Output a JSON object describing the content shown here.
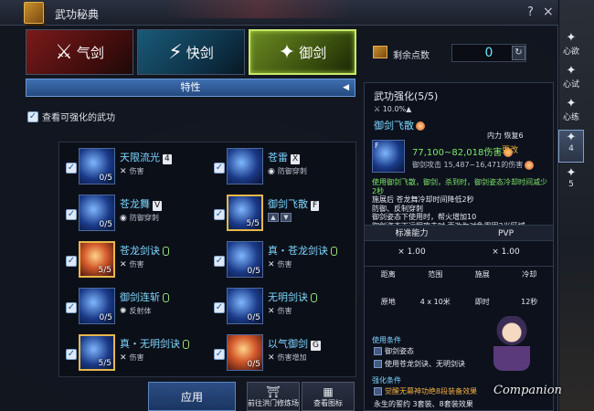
{
  "window": {
    "title": "武功秘典",
    "help": "?",
    "close": "×"
  },
  "tabs": [
    {
      "label": "气剑"
    },
    {
      "label": "快剑"
    },
    {
      "label": "御剑",
      "selected": true
    }
  ],
  "points": {
    "label": "剩余点数",
    "value": "0"
  },
  "feature_bar": {
    "label": "特性"
  },
  "filter": {
    "label": "查看可强化的武功",
    "checked": true
  },
  "skills": [
    {
      "name": "天限流光",
      "key": "4",
      "level": "0/5",
      "tag": "伤害"
    },
    {
      "name": "苍雷",
      "key": "X",
      "level": "",
      "tag": "防御穿刺"
    },
    {
      "name": "苍龙舞",
      "key": "V",
      "level": "0/5",
      "tag": "防御穿刺"
    },
    {
      "name": "御剑飞散",
      "key": "F",
      "level": "5/5",
      "tag": ""
    },
    {
      "name": "苍龙剑诀",
      "key": "",
      "level": "5/5",
      "tag": "伤害"
    },
    {
      "name": "真・苍龙剑诀",
      "key": "",
      "level": "0/5",
      "tag": "伤害"
    },
    {
      "name": "御剑连斩",
      "key": "",
      "level": "0/5",
      "tag": "反射体"
    },
    {
      "name": "无明剑诀",
      "key": "",
      "level": "0/5",
      "tag": "伤害"
    },
    {
      "name": "真・无明剑诀",
      "key": "",
      "level": "5/5",
      "tag": "伤害"
    },
    {
      "name": "以气御剑",
      "key": "G",
      "level": "0/5",
      "tag": "伤害增加"
    }
  ],
  "buttons": {
    "apply": "应用",
    "training": "前往洪门修炼场",
    "view_icons": "查看图标"
  },
  "detail": {
    "title": "武功强化(5/5)",
    "percent": "10.0%▲",
    "skill_name": "御剑飞散",
    "internal": "内力 恢复6",
    "damage": "77,100~82,018伤害",
    "change": "更改",
    "attack": "御剑攻击 15,487~16,471的伤害",
    "effects_green": "使用御剑飞散，御剑，杀到时，御剑姿态冷却时间减少2秒",
    "effects_1": "施展后 苍龙舞冷却时间降低2秒",
    "effects_2": "防御、反制穿刺",
    "effects_3": "御剑姿态下使用时，帮火增加10",
    "effects_4": "御剑姿态下远程攻击时 更改为对象周围3米区域",
    "table_head": [
      "标准能力",
      "PVP"
    ],
    "mult_1": "× 1.00",
    "mult_2": "× 1.00",
    "stat_head": [
      "距离",
      "范围",
      "施展",
      "冷却"
    ],
    "stat_val": [
      "原地",
      "4 x 10米",
      "即时",
      "12秒"
    ],
    "use_label": "使用条件",
    "use_1": "御剑姿态",
    "use_2": "使用苍龙剑诀、无明剑诀",
    "str_label": "强化条件",
    "str_1": "觉醒无幕神功绝8段装备效果",
    "str_2": "永生的誓约 3套装、8套装效果"
  },
  "side_tabs": [
    {
      "label": "心欲"
    },
    {
      "label": "心试"
    },
    {
      "label": "心练"
    },
    {
      "label": "4"
    },
    {
      "label": "5"
    }
  ],
  "companion": "Companion"
}
